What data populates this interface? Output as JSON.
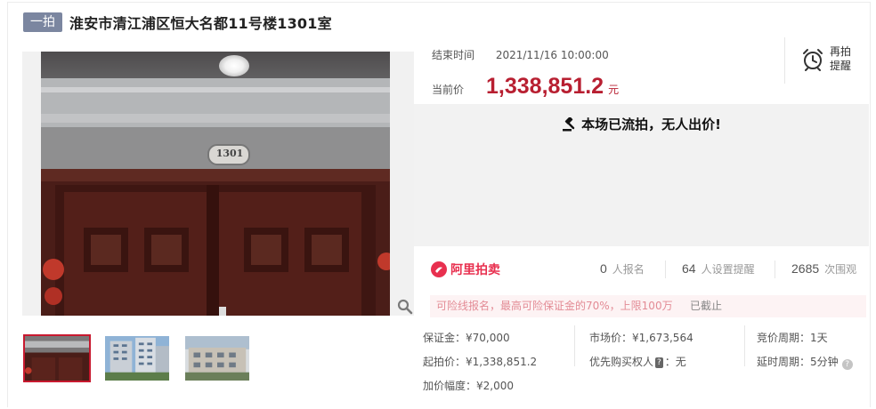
{
  "header": {
    "tag": "一拍",
    "title": "淮安市清江浦区恒大名都11号楼1301室"
  },
  "photo": {
    "door_plate": "1301"
  },
  "auction": {
    "end_time_label": "结束时间",
    "end_time": "2021/11/16 10:00:00",
    "price_label": "当前价",
    "price": "1,338,851.2",
    "price_unit": "元",
    "remind_label_1": "再拍",
    "remind_label_2": "提醒",
    "status": "本场已流拍，无人出价!"
  },
  "stats": {
    "brand": "阿里拍卖",
    "signups": "0",
    "signups_label": "人报名",
    "reminders": "64",
    "reminders_label": "人设置提醒",
    "views": "2685",
    "views_label": "次围观"
  },
  "notice": {
    "text": "可险线报名，最高可险保证金的70%，上限100万",
    "status": "已截止"
  },
  "details": {
    "deposit": "保证金：¥70,000",
    "start_price": "起拍价：¥1,338,851.2",
    "increment": "加价幅度：¥2,000",
    "market_price": "市场价：¥1,673,564",
    "priority_buyer_label": "优先购买权人",
    "priority_buyer_badge": "?",
    "priority_buyer_value": "：无",
    "bid_period": "竞价周期：1天",
    "delay_period": "延时周期：5分钟"
  },
  "colors": {
    "accent": "#b81f31",
    "tag_bg": "#7b86a0",
    "brand": "#e8304f",
    "notice_bg": "#fdf3f4"
  },
  "icons": {
    "zoom": "magnifier-icon",
    "remind": "alarm-clock-icon",
    "status": "gavel-icon",
    "help": "question-icon"
  }
}
